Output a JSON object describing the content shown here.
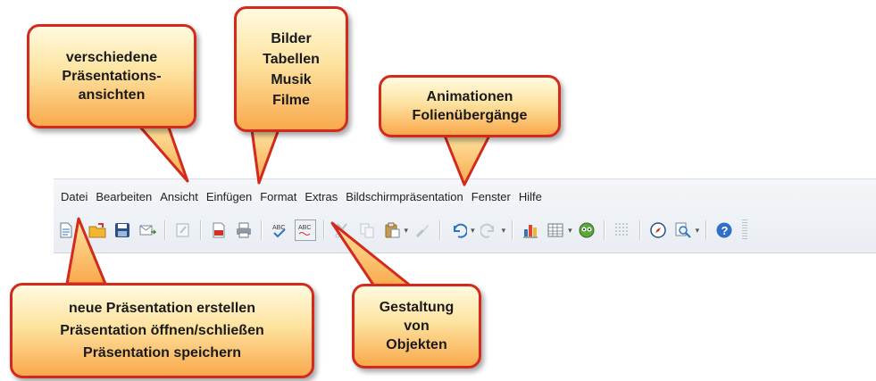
{
  "menu": [
    "Datei",
    "Bearbeiten",
    "Ansicht",
    "Einfügen",
    "Format",
    "Extras",
    "Bildschirmpräsentation",
    "Fenster",
    "Hilfe"
  ],
  "toolbar_icons": [
    "new-document-icon",
    "open-folder-icon",
    "save-icon",
    "email-icon",
    "edit-file-icon",
    "export-pdf-icon",
    "print-icon",
    "spellcheck-icon",
    "autospellcheck-icon",
    "cut-icon",
    "copy-icon",
    "paste-icon",
    "format-paintbrush-icon",
    "undo-icon",
    "redo-icon",
    "chart-icon",
    "table-icon",
    "media-icon",
    "grid-icon",
    "navigator-icon",
    "zoom-icon",
    "help-icon"
  ],
  "callouts": {
    "views": [
      "verschiedene",
      "Präsentations-",
      "ansichten"
    ],
    "insert": [
      "Bilder",
      "Tabellen",
      "Musik",
      "Filme"
    ],
    "animations": [
      "Animationen",
      "Folienübergänge"
    ],
    "file": [
      "neue Präsentation erstellen",
      "Präsentation öffnen/schließen",
      "Präsentation speichern"
    ],
    "format": [
      "Gestaltung",
      "von",
      "Objekten"
    ]
  },
  "colors": {
    "callout_border": "#d22a1e",
    "callout_top": "#fffadf",
    "callout_bottom": "#f9a94c"
  }
}
